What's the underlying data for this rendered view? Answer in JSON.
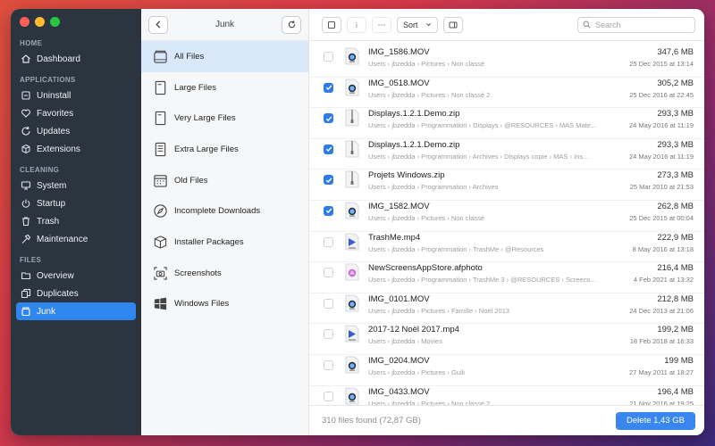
{
  "colors": {
    "accent": "#2f87ee",
    "sidebar_bg": "#2b3540",
    "close": "#ff5f57",
    "minimize": "#febc2e",
    "zoom": "#28c840"
  },
  "sidebar": {
    "sections": [
      {
        "title": "HOME",
        "items": [
          {
            "label": "Dashboard",
            "icon": "home-icon"
          }
        ]
      },
      {
        "title": "APPLICATIONS",
        "items": [
          {
            "label": "Uninstall",
            "icon": "uninstall-icon"
          },
          {
            "label": "Favorites",
            "icon": "heart-icon"
          },
          {
            "label": "Updates",
            "icon": "refresh-icon"
          },
          {
            "label": "Extensions",
            "icon": "cube-icon"
          }
        ]
      },
      {
        "title": "CLEANING",
        "items": [
          {
            "label": "System",
            "icon": "monitor-icon"
          },
          {
            "label": "Startup",
            "icon": "power-icon"
          },
          {
            "label": "Trash",
            "icon": "trash-icon"
          },
          {
            "label": "Maintenance",
            "icon": "hammer-icon"
          }
        ]
      },
      {
        "title": "FILES",
        "items": [
          {
            "label": "Overview",
            "icon": "folder-icon"
          },
          {
            "label": "Duplicates",
            "icon": "duplicates-icon"
          },
          {
            "label": "Junk",
            "icon": "junk-icon",
            "active": true
          }
        ]
      }
    ]
  },
  "middle": {
    "title": "Junk",
    "categories": [
      {
        "label": "All Files",
        "icon": "all-files-icon",
        "active": true
      },
      {
        "label": "Large Files",
        "icon": "file-icon"
      },
      {
        "label": "Very Large Files",
        "icon": "file-icon"
      },
      {
        "label": "Extra Large Files",
        "icon": "file-lines-icon"
      },
      {
        "label": "Old Files",
        "icon": "calendar-icon"
      },
      {
        "label": "Incomplete Downloads",
        "icon": "compass-icon"
      },
      {
        "label": "Installer Packages",
        "icon": "package-icon"
      },
      {
        "label": "Screenshots",
        "icon": "camera-icon"
      },
      {
        "label": "Windows Files",
        "icon": "windows-icon"
      }
    ]
  },
  "toolbar": {
    "sort_label": "Sort",
    "search_placeholder": "Search"
  },
  "files": [
    {
      "name": "IMG_1586.MOV",
      "path": "Users › jbzedda › Pictures › Non classé",
      "size": "347,6 MB",
      "date": "25 Dec 2015 at 13:14",
      "checked": false,
      "icon": "video-file-icon"
    },
    {
      "name": "IMG_0518.MOV",
      "path": "Users › jbzedda › Pictures › Non classé 2",
      "size": "305,2 MB",
      "date": "25 Dec 2016 at 22:45",
      "checked": true,
      "icon": "video-file-icon"
    },
    {
      "name": "Displays.1.2.1.Demo.zip",
      "path": "Users › jbzedda › Programmation › Displays › @RESOURCES › MAS Mate...",
      "size": "293,3 MB",
      "date": "24 May 2016 at 11:19",
      "checked": true,
      "icon": "zip-file-icon"
    },
    {
      "name": "Displays.1.2.1.Demo.zip",
      "path": "Users › jbzedda › Programmation › Archives › Displays copie › MAS › Ins...",
      "size": "293,3 MB",
      "date": "24 May 2016 at 11:19",
      "checked": true,
      "icon": "zip-file-icon"
    },
    {
      "name": "Projets Windows.zip",
      "path": "Users › jbzedda › Programmation › Archives",
      "size": "273,3 MB",
      "date": "25 Mar 2010 at 21:53",
      "checked": true,
      "icon": "zip-file-icon"
    },
    {
      "name": "IMG_1582.MOV",
      "path": "Users › jbzedda › Pictures › Non classé",
      "size": "262,8 MB",
      "date": "25 Dec 2015 at 00:04",
      "checked": true,
      "icon": "video-file-icon"
    },
    {
      "name": "TrashMe.mp4",
      "path": "Users › jbzedda › Programmation › TrashMe › @Resources",
      "size": "222,9 MB",
      "date": "8 May 2016 at 13:18",
      "checked": false,
      "icon": "mp4-file-icon"
    },
    {
      "name": "NewScreensAppStore.afphoto",
      "path": "Users › jbzedda › Programmation › TrashMe 3 › @RESOURCES › Screens...",
      "size": "216,4 MB",
      "date": "4 Feb 2021 at 13:32",
      "checked": false,
      "icon": "afphoto-file-icon"
    },
    {
      "name": "IMG_0101.MOV",
      "path": "Users › jbzedda › Pictures › Famille › Noël 2013",
      "size": "212,8 MB",
      "date": "24 Dec 2013 at 21:06",
      "checked": false,
      "icon": "video-file-icon"
    },
    {
      "name": "2017-12 Noël 2017.mp4",
      "path": "Users › jbzedda › Movies",
      "size": "199,2 MB",
      "date": "18 Feb 2018 at 16:33",
      "checked": false,
      "icon": "mp4-file-icon"
    },
    {
      "name": "IMG_0204.MOV",
      "path": "Users › jbzedda › Pictures › Guili",
      "size": "199 MB",
      "date": "27 May 2011 at 18:27",
      "checked": false,
      "icon": "video-file-icon"
    },
    {
      "name": "IMG_0433.MOV",
      "path": "Users › jbzedda › Pictures › Non classé 2",
      "size": "196,4 MB",
      "date": "21 Nov 2016 at 19:25",
      "checked": false,
      "icon": "video-file-icon"
    }
  ],
  "footer": {
    "found_text": "310 files found (72,87 GB)",
    "delete_label": "Delete 1,43 GB"
  }
}
